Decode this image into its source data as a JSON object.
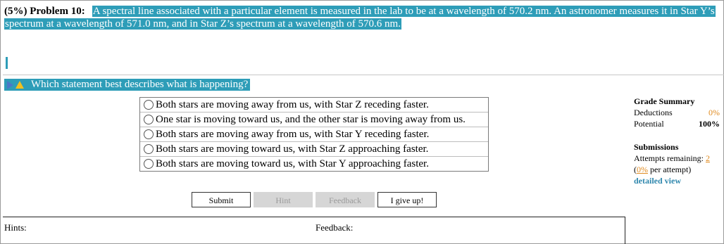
{
  "problem": {
    "weight": "(5%)",
    "label": "Problem 10:",
    "statement": "A spectral line associated with a particular element is measured in the lab to be at a wavelength of 570.2 nm. An astronomer measures it in Star Y’s spectrum at a wavelength of 571.0 nm, and in Star Z’s spectrum at a wavelength of 570.6 nm."
  },
  "question": {
    "text": "Which statement best describes what is happening?"
  },
  "choices": [
    "Both stars are moving away from us, with Star Z receding faster.",
    "One star is moving toward us, and the other star is moving away from us.",
    "Both stars are moving away from us, with Star Y receding faster.",
    "Both stars are moving toward us, with Star Z approaching faster.",
    "Both stars are moving toward us, with Star Y approaching faster."
  ],
  "buttons": {
    "submit": "Submit",
    "hint": "Hint",
    "feedback": "Feedback",
    "give_up": "I give up!"
  },
  "grade_summary": {
    "title": "Grade Summary",
    "deductions_label": "Deductions",
    "deductions_value": "0%",
    "potential_label": "Potential",
    "potential_value": "100%"
  },
  "submissions": {
    "title": "Submissions",
    "attempts_label": "Attempts remaining:",
    "attempts_value": "2",
    "per_attempt_open": "(",
    "per_attempt_value": "0%",
    "per_attempt_close": " per attempt)",
    "detailed_view": "detailed view"
  },
  "panels": {
    "hints_label": "Hints:",
    "feedback_label": "Feedback:"
  },
  "colors": {
    "highlight": "#2e9db8",
    "orange": "#e08a1e",
    "link": "#2e87ad"
  },
  "icons": {
    "play": "play-icon",
    "warning": "warning-icon"
  }
}
